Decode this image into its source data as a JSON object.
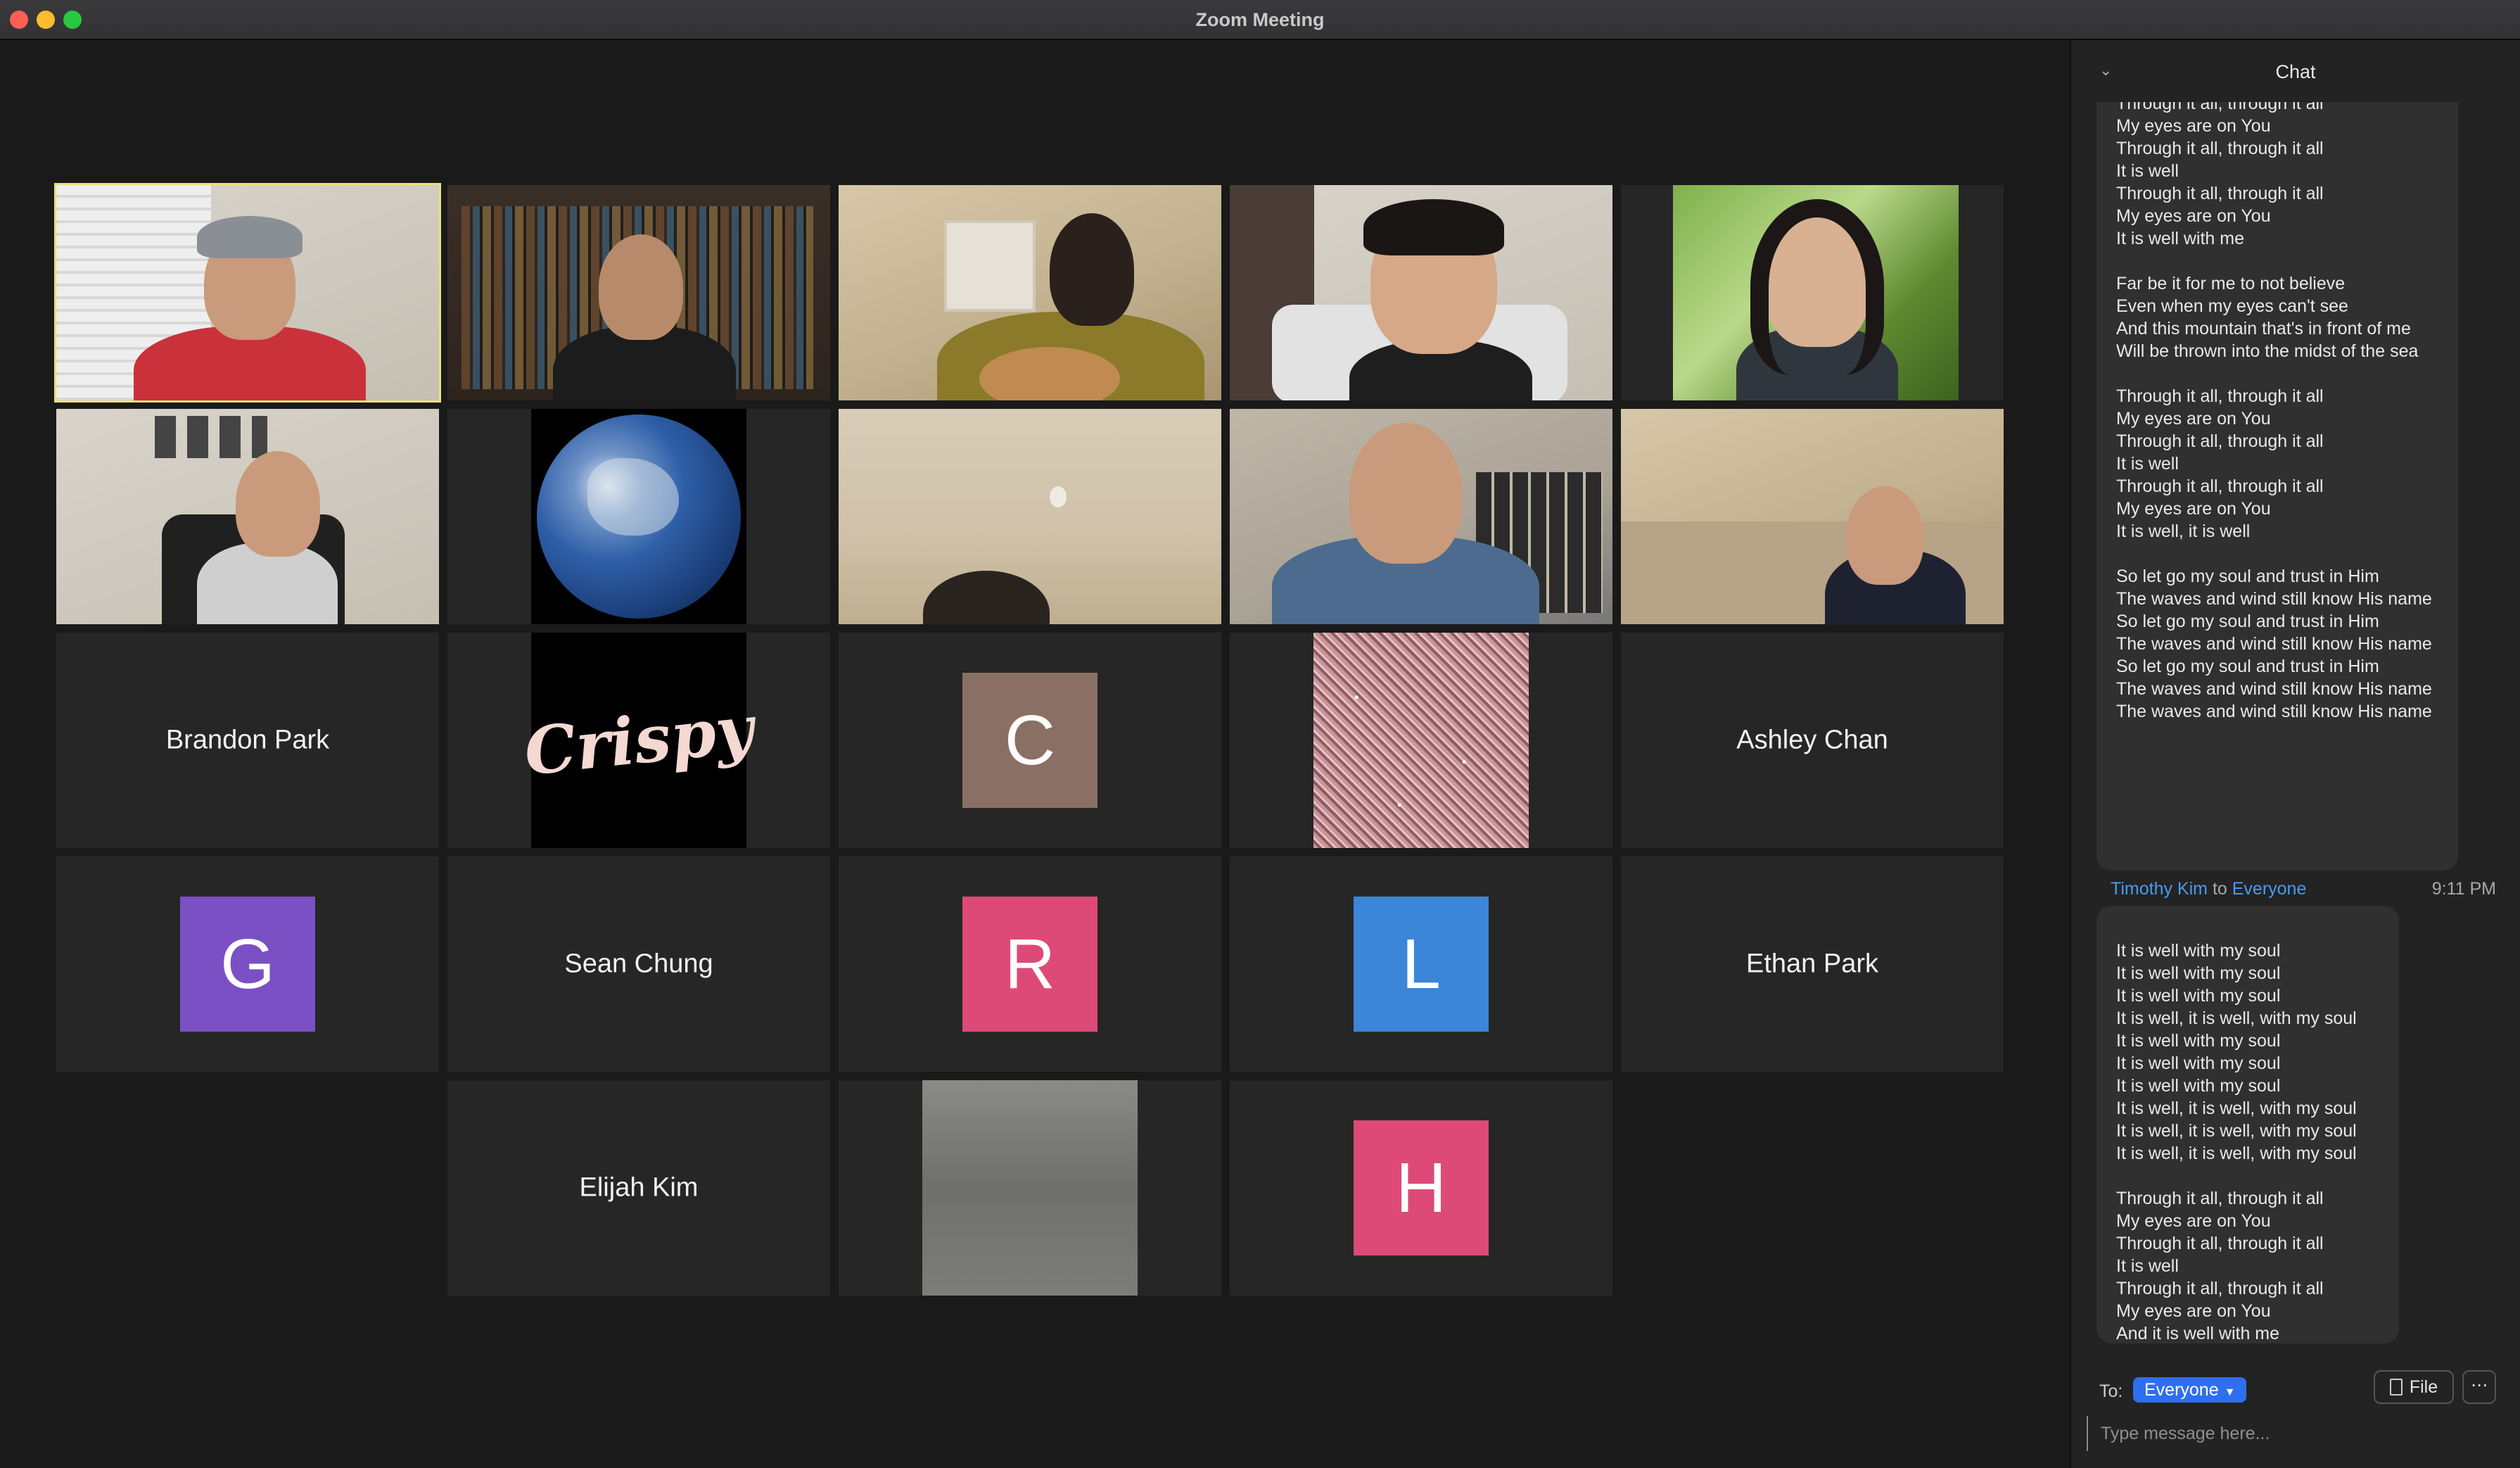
{
  "window": {
    "title": "Zoom Meeting"
  },
  "gallery": {
    "names": {
      "brandon": "Brandon Park",
      "ashley": "Ashley Chan",
      "sean": "Sean Chung",
      "ethan": "Ethan Park",
      "elijah": "Elijah Kim"
    },
    "avatars": {
      "c": {
        "letter": "C",
        "color": "#8a7064"
      },
      "g": {
        "letter": "G",
        "color": "#7a50c4"
      },
      "r": {
        "letter": "R",
        "color": "#de4a78"
      },
      "l": {
        "letter": "L",
        "color": "#3b86d8"
      },
      "h": {
        "letter": "H",
        "color": "#de4a78"
      }
    },
    "crispy_text": "Crispy"
  },
  "chat": {
    "title": "Chat",
    "message1_text": "Through it all, through it all\nMy eyes are on You\nThrough it all, through it all\nIt is well\nThrough it all, through it all\nMy eyes are on You\nIt is well with me\n\nFar be it for me to not believe\nEven when my eyes can't see\nAnd this mountain that's in front of me\nWill be thrown into the midst of the sea\n\nThrough it all, through it all\nMy eyes are on You\nThrough it all, through it all\nIt is well\nThrough it all, through it all\nMy eyes are on You\nIt is well, it is well\n\nSo let go my soul and trust in Him\nThe waves and wind still know His name\nSo let go my soul and trust in Him\nThe waves and wind still know His name\nSo let go my soul and trust in Him\nThe waves and wind still know His name\nThe waves and wind still know His name",
    "message2": {
      "sender": "Timothy Kim",
      "to_word": "to",
      "recipient": "Everyone",
      "time": "9:11 PM",
      "text": "It is well with my soul\nIt is well with my soul\nIt is well with my soul\nIt is well, it is well, with my soul\nIt is well with my soul\nIt is well with my soul\nIt is well with my soul\nIt is well, it is well, with my soul\nIt is well, it is well, with my soul\nIt is well, it is well, with my soul\n\nThrough it all, through it all\nMy eyes are on You\nThrough it all, through it all\nIt is well\nThrough it all, through it all\nMy eyes are on You\nAnd it is well with me"
    },
    "to_label": "To:",
    "to_value": "Everyone",
    "file_label": "File",
    "more_label": "⋯",
    "input_placeholder": "Type message here..."
  }
}
